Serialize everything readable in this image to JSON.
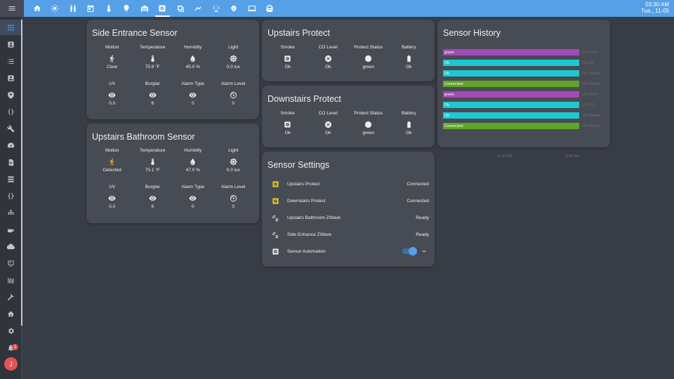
{
  "topbar": {
    "menu_icon": "hamburger-icon",
    "tabs": [
      {
        "icon": "home-icon"
      },
      {
        "icon": "weather-icon"
      },
      {
        "icon": "people-icon"
      },
      {
        "icon": "calendar-icon"
      },
      {
        "icon": "thermometer-icon"
      },
      {
        "icon": "lightbulb-icon"
      },
      {
        "icon": "garage-icon"
      },
      {
        "icon": "smoke-detector-icon",
        "active": true
      },
      {
        "icon": "camera-icon"
      },
      {
        "icon": "drone-icon"
      },
      {
        "icon": "sprinkler-icon"
      },
      {
        "icon": "bug-icon"
      },
      {
        "icon": "laptop-icon"
      },
      {
        "icon": "robot-vacuum-icon"
      }
    ],
    "time": "03:30 AM",
    "date": "Tue., 11-05"
  },
  "sidebar": {
    "notification_count": "1",
    "avatar_initial": "J"
  },
  "side_entrance": {
    "title": "Side Entrance Sensor",
    "row1": [
      {
        "label": "Motion",
        "value": "Clear",
        "icon": "walk-icon"
      },
      {
        "label": "Temperature",
        "value": "75.9 °F",
        "icon": "thermometer-icon"
      },
      {
        "label": "Humidity",
        "value": "45.0 %",
        "icon": "water-drop-icon"
      },
      {
        "label": "Light",
        "value": "0.0 lux",
        "icon": "brightness-icon"
      }
    ],
    "row2": [
      {
        "label": "UV",
        "value": "0.0",
        "icon": "eye-icon"
      },
      {
        "label": "Burglar",
        "value": "8",
        "icon": "eye-icon"
      },
      {
        "label": "Alarm Type",
        "value": "0",
        "icon": "eye-icon"
      },
      {
        "label": "Alarm Level",
        "value": "0",
        "icon": "gauge-icon"
      }
    ]
  },
  "upstairs_bathroom": {
    "title": "Upstairs Bathroom Sensor",
    "row1": [
      {
        "label": "Motion",
        "value": "Detected",
        "icon": "run-icon"
      },
      {
        "label": "Temperature",
        "value": "75.1 °F",
        "icon": "thermometer-icon"
      },
      {
        "label": "Humidity",
        "value": "47.0 %",
        "icon": "water-drop-icon"
      },
      {
        "label": "Light",
        "value": "0.0 lux",
        "icon": "brightness-icon"
      }
    ],
    "row2": [
      {
        "label": "UV",
        "value": "0.0",
        "icon": "eye-icon"
      },
      {
        "label": "Burglar",
        "value": "8",
        "icon": "eye-icon"
      },
      {
        "label": "Alarm Type",
        "value": "0",
        "icon": "eye-icon"
      },
      {
        "label": "Alarm Level",
        "value": "0",
        "icon": "gauge-icon"
      }
    ]
  },
  "upstairs_protect": {
    "title": "Upstairs Protect",
    "cells": [
      {
        "label": "Smoke",
        "value": "Ok",
        "icon": "smoke-detector-icon"
      },
      {
        "label": "CO Level",
        "value": "Ok",
        "icon": "close-circle-icon"
      },
      {
        "label": "Protect Status",
        "value": "green",
        "icon": "circle-icon"
      },
      {
        "label": "Battery",
        "value": "Ok",
        "icon": "battery-icon"
      }
    ]
  },
  "downstairs_protect": {
    "title": "Downstairs Protect",
    "cells": [
      {
        "label": "Smoke",
        "value": "Ok",
        "icon": "smoke-detector-icon"
      },
      {
        "label": "CO Level",
        "value": "Ok",
        "icon": "close-circle-icon"
      },
      {
        "label": "Protect Status",
        "value": "green",
        "icon": "circle-icon"
      },
      {
        "label": "Battery",
        "value": "Ok",
        "icon": "battery-icon"
      }
    ]
  },
  "sensor_settings": {
    "title": "Sensor Settings",
    "rows": [
      {
        "name": "Upstairs Protect",
        "state": "Connected",
        "icon": "smoke-detector-icon"
      },
      {
        "name": "Downstairs Protect",
        "state": "Connected",
        "icon": "smoke-detector-icon"
      },
      {
        "name": "Upstairs Bathroom ZWave",
        "state": "Ready",
        "icon": "zwave-icon"
      },
      {
        "name": "Side Entrance ZWave",
        "state": "Ready",
        "icon": "zwave-icon"
      },
      {
        "name": "Sensor Automation",
        "state": "",
        "icon": "automation-icon"
      }
    ],
    "automation_enabled": true
  },
  "sensor_history": {
    "title": "Sensor History",
    "rows": [
      {
        "value": "green",
        "name": "DS Color",
        "color": "#a24bb6"
      },
      {
        "value": "Ok",
        "name": "DS CO",
        "color": "#1ec8d2"
      },
      {
        "value": "Ok",
        "name": "DS Smoke",
        "color": "#1ec8d2"
      },
      {
        "value": "Connected",
        "name": "DS Online",
        "color": "#5ea628"
      },
      {
        "value": "green",
        "name": "US Color",
        "color": "#a24bb6"
      },
      {
        "value": "Ok",
        "name": "US CO",
        "color": "#1ec8d2"
      },
      {
        "value": "Ok",
        "name": "US Smoke",
        "color": "#1ec8d2"
      },
      {
        "value": "Connected",
        "name": "US Online",
        "color": "#5ea628"
      }
    ],
    "axis_labels": [
      "3:00 PM",
      "3:45 AM"
    ]
  }
}
